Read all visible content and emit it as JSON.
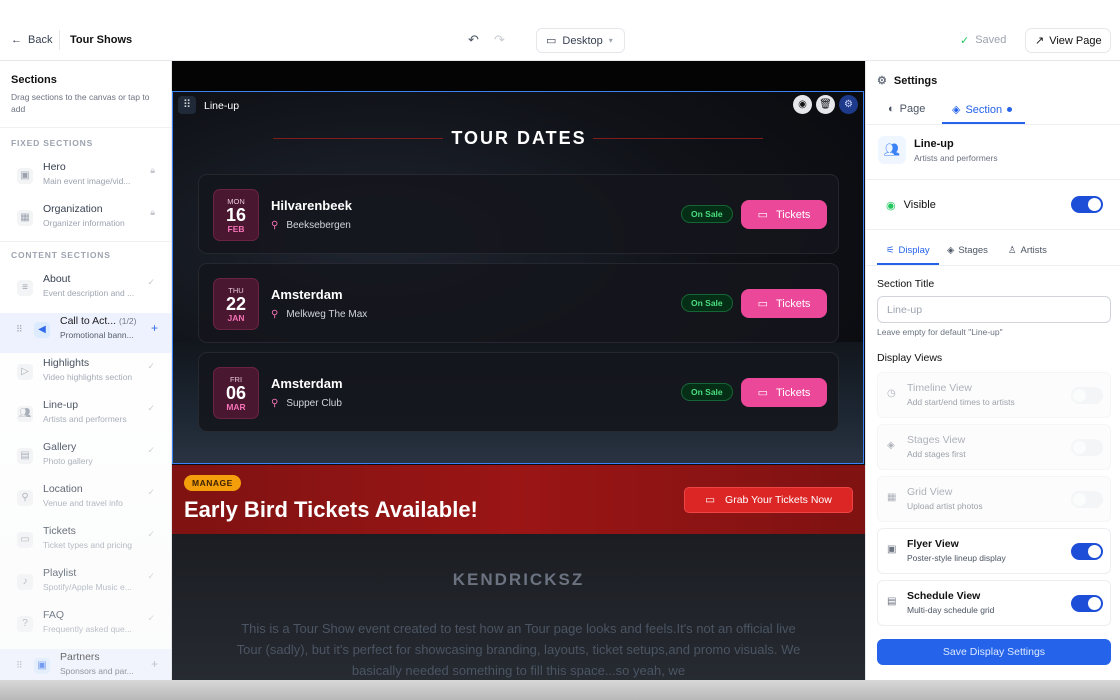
{
  "topbar": {
    "back_label": "Back",
    "page_title": "Tour Shows",
    "device_label": "Desktop",
    "saved_label": "Saved",
    "view_page_label": "View Page"
  },
  "left_panel": {
    "title": "Sections",
    "subtitle": "Drag sections to the canvas or tap to add",
    "fixed_heading": "FIXED SECTIONS",
    "content_heading": "CONTENT SECTIONS",
    "fixed": [
      {
        "name": "Hero",
        "desc": "Main event image/vid..."
      },
      {
        "name": "Organization",
        "desc": "Organizer information"
      }
    ],
    "content": [
      {
        "name": "About",
        "desc": "Event description and ..."
      },
      {
        "name": "Call to Act...",
        "count": "(1/2)",
        "desc": "Promotional bann..."
      },
      {
        "name": "Highlights",
        "desc": "Video highlights section"
      },
      {
        "name": "Line-up",
        "desc": "Artists and performers"
      },
      {
        "name": "Gallery",
        "desc": "Photo gallery"
      },
      {
        "name": "Location",
        "desc": "Venue and travel info"
      },
      {
        "name": "Tickets",
        "desc": "Ticket types and pricing"
      },
      {
        "name": "Playlist",
        "desc": "Spotify/Apple Music e..."
      },
      {
        "name": "FAQ",
        "desc": "Frequently asked que..."
      },
      {
        "name": "Partners",
        "desc": "Sponsors and par..."
      }
    ]
  },
  "canvas": {
    "lineup_label": "Line-up",
    "tour_title": "TOUR DATES",
    "events": [
      {
        "dow": "MON",
        "day": "16",
        "month": "FEB",
        "city": "Hilvarenbeek",
        "venue": "Beeksebergen",
        "status": "On Sale",
        "button": "Tickets"
      },
      {
        "dow": "THU",
        "day": "22",
        "month": "JAN",
        "city": "Amsterdam",
        "venue": "Melkweg The Max",
        "status": "On Sale",
        "button": "Tickets"
      },
      {
        "dow": "FRI",
        "day": "06",
        "month": "MAR",
        "city": "Amsterdam",
        "venue": "Supper Club",
        "status": "On Sale",
        "button": "Tickets"
      }
    ],
    "promo": {
      "badge": "MANAGE",
      "title": "Early Bird Tickets Available!",
      "button": "Grab Your Tickets Now"
    },
    "about": {
      "title": "KENDRICKSZ",
      "text": "This is a Tour Show event created to test how an Tour page looks and feels.It's not an official live Tour (sadly), but it's perfect for showcasing branding, layouts, ticket setups,and promo visuals. We basically needed something to fill this space...so yeah, we"
    }
  },
  "right_panel": {
    "header": "Settings",
    "tabs": [
      "Page",
      "Section"
    ],
    "section_name": "Line-up",
    "section_desc": "Artists and performers",
    "visible_label": "Visible",
    "visible_on": true,
    "subtabs": [
      "Display",
      "Stages",
      "Artists"
    ],
    "section_title_label": "Section Title",
    "section_title_placeholder": "Line-up",
    "section_title_help": "Leave empty for default \"Line-up\"",
    "display_views_label": "Display Views",
    "views": [
      {
        "title": "Timeline View",
        "desc": "Add start/end times to artists",
        "enabled": false,
        "disabled": true
      },
      {
        "title": "Stages View",
        "desc": "Add stages first",
        "enabled": false,
        "disabled": true
      },
      {
        "title": "Grid View",
        "desc": "Upload artist photos",
        "enabled": false,
        "disabled": true
      },
      {
        "title": "Flyer View",
        "desc": "Poster-style lineup display",
        "enabled": true,
        "disabled": false
      },
      {
        "title": "Schedule View",
        "desc": "Multi-day schedule grid",
        "enabled": true,
        "disabled": false
      }
    ],
    "save_label": "Save Display Settings"
  },
  "colors": {
    "accent": "#2563eb",
    "ticket_pink": "#ec4899",
    "on_sale_green": "#4ade80",
    "promo_red": "#9b1515",
    "badge_amber": "#f59e0b"
  }
}
